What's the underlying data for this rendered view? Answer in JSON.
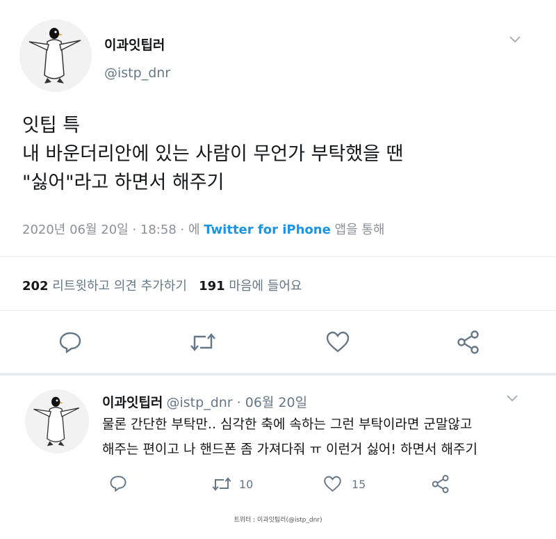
{
  "main_tweet": {
    "display_name": "이과잇팁러",
    "handle": "@istp_dnr",
    "lines": [
      "잇팁 특",
      "내 바운더리안에 있는 사람이 무언가 부탁했을 땐",
      "\"싫어\"라고 하면서 해주기"
    ],
    "timestamp": "2020년 06월 20일 · 18:58 · 에 ",
    "source": "Twitter for iPhone",
    "source_suffix": " 앱을 통해",
    "retweet_count": "202",
    "retweet_label": " 리트윗하고 의견 추가하기",
    "like_count": "191",
    "like_label": " 마음에 들어요"
  },
  "reply_tweet": {
    "display_name": "이과잇팁러",
    "handle": "@istp_dnr",
    "date": " · 06월 20일",
    "lines": [
      "물론 간단한 부탁만.. 심각한 축에 속하는 그런 부탁이라면 군말않고",
      "해주는 편이고 나 핸드폰 좀 가져다줘 ㅠ 이런거 싫어! 하면서 해주기"
    ],
    "retweets": "10",
    "likes": "15"
  },
  "footer_credit": "트위터 : 이과잇팁러(@istp_dnr)",
  "icons": [
    "penguin-avatar-icon",
    "chevron-down-icon",
    "reply-icon",
    "retweet-icon",
    "like-icon",
    "share-icon"
  ],
  "colors": {
    "link": "#1b95e0",
    "muted": "#657786",
    "divider": "#e6ecf0"
  }
}
